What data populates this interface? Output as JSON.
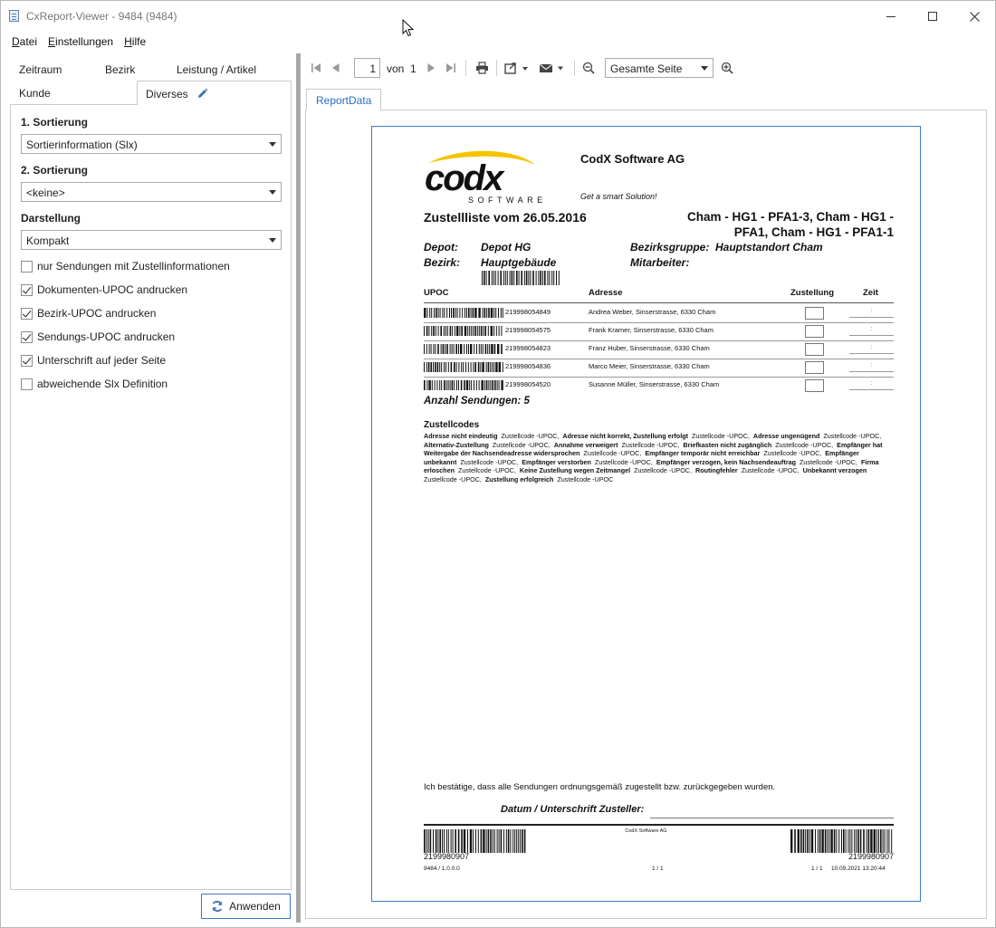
{
  "window": {
    "title": "CxReport-Viewer - 9484 (9484)"
  },
  "menu": [
    {
      "label": "Datei",
      "key": "D",
      "rest": "atei"
    },
    {
      "label": "Einstellungen",
      "key": "E",
      "rest": "instellungen"
    },
    {
      "label": "Hilfe",
      "key": "H",
      "rest": "ilfe"
    }
  ],
  "left_tabs": {
    "row1": [
      "Zeitraum",
      "Bezirk",
      "Leistung / Artikel"
    ],
    "kunde": "Kunde",
    "diverses": "Diverses"
  },
  "settings": {
    "sort1_label": "1. Sortierung",
    "sort1_value": "Sortierinformation (Slx)",
    "sort2_label": "2. Sortierung",
    "sort2_value": "<keine>",
    "display_label": "Darstellung",
    "display_value": "Kompakt",
    "checkboxes": [
      {
        "label": "nur Sendungen mit Zustellinformationen",
        "checked": false
      },
      {
        "label": "Dokumenten-UPOC andrucken",
        "checked": true
      },
      {
        "label": "Bezirk-UPOC andrucken",
        "checked": true
      },
      {
        "label": "Sendungs-UPOC andrucken",
        "checked": true
      },
      {
        "label": "Unterschrift auf jeder Seite",
        "checked": true
      },
      {
        "label": "abweichende Slx Definition",
        "checked": false
      }
    ],
    "apply_label": "Anwenden"
  },
  "toolbar": {
    "page_current": "1",
    "page_of": "von",
    "page_total": "1",
    "zoom_value": "Gesamte Seite"
  },
  "report_tab": "ReportData",
  "report": {
    "logo_text": "codx",
    "logo_sub": "SOFTWARE",
    "company": "CodX Software AG",
    "slogan": "Get a smart Solution!",
    "title": "Zustellliste vom 26.05.2016",
    "route_line1": "Cham - HG1 - PFA1-3, Cham - HG1 -",
    "route_line2": "PFA1, Cham - HG1 - PFA1-1",
    "depot_label": "Depot:",
    "depot_value": "Depot HG",
    "bezirk_label": "Bezirk:",
    "bezirk_value": "Hauptgebäude",
    "bezirksgruppe_label": "Bezirksgruppe:",
    "bezirksgruppe_value": "Hauptstandort Cham",
    "mitarbeiter_label": "Mitarbeiter:",
    "columns": {
      "upoc": "UPOC",
      "adresse": "Adresse",
      "zustellung": "Zustellung",
      "zeit": "Zeit"
    },
    "rows": [
      {
        "upoc": "219998054849",
        "address": "Andrea Weber, Sinserstrasse, 6330 Cham",
        "time": ":"
      },
      {
        "upoc": "219998054575",
        "address": "Frank Kramer, Sinserstrasse, 6330 Cham",
        "time": ":"
      },
      {
        "upoc": "219998054823",
        "address": "Franz Huber, Sinserstrasse, 6330 Cham",
        "time": ":"
      },
      {
        "upoc": "219998054836",
        "address": "Marco Meier, Sinserstrasse, 6330 Cham",
        "time": ":"
      },
      {
        "upoc": "219998054520",
        "address": "Susanne Müller, Sinserstrasse, 6330 Cham",
        "time": ":"
      }
    ],
    "count_text": "Anzahl Sendungen: 5",
    "zustellcodes_title": "Zustellcodes",
    "zustellcodes": [
      {
        "b": "Adresse nicht eindeutig",
        "t": "Zustellcode -UPOC,"
      },
      {
        "b": "Adresse nicht korrekt, Zustellung erfolgt",
        "t": "Zustellcode -UPOC,"
      },
      {
        "b": "Adresse ungenügend",
        "t": "Zustellcode -UPOC,"
      },
      {
        "b": "Alternativ-Zustellung",
        "t": "Zustellcode -UPOC,"
      },
      {
        "b": "Annahme verweigert",
        "t": "Zustellcode -UPOC,"
      },
      {
        "b": "Briefkasten nicht zugänglich",
        "t": "Zustellcode -UPOC,"
      },
      {
        "b": "Empfänger hat Weitergabe der Nachsendeadresse widersprochen",
        "t": "Zustellcode -UPOC,"
      },
      {
        "b": "Empfänger temporär nicht erreichbar",
        "t": "Zustellcode -UPOC,"
      },
      {
        "b": "Empfänger unbekannt",
        "t": "Zustellcode -UPOC,"
      },
      {
        "b": "Empfänger verstorben",
        "t": "Zustellcode -UPOC,"
      },
      {
        "b": "Empfänger verzogen, kein Nachsendeauftrag",
        "t": "Zustellcode -UPOC,"
      },
      {
        "b": "Firma erloschen",
        "t": "Zustellcode -UPOC,"
      },
      {
        "b": "Keine Zustellung wegen Zeitmangel",
        "t": "Zustellcode -UPOC,"
      },
      {
        "b": "Routingfehler",
        "t": "Zustellcode -UPOC,"
      },
      {
        "b": "Unbekannt verzogen",
        "t": "Zustellcode -UPOC,"
      },
      {
        "b": "Zustellung erfolgreich",
        "t": "Zustellcode -UPOC"
      }
    ],
    "confirm_text": "Ich bestätige, dass alle Sendungen ordnungsgemäß zugestellt bzw. zurückgegeben wurden.",
    "signature_label": "Datum / Unterschrift Zusteller:",
    "footer_company": "CodX Software AG",
    "footer_barcode_left": "2199980907",
    "footer_barcode_right": "2199980907",
    "footer_version": "9484 / 1.0.0.0",
    "footer_page_center": "1 / 1",
    "footer_page_right": "1 / 1",
    "footer_timestamp": "10.09.2021 13:20:44"
  }
}
